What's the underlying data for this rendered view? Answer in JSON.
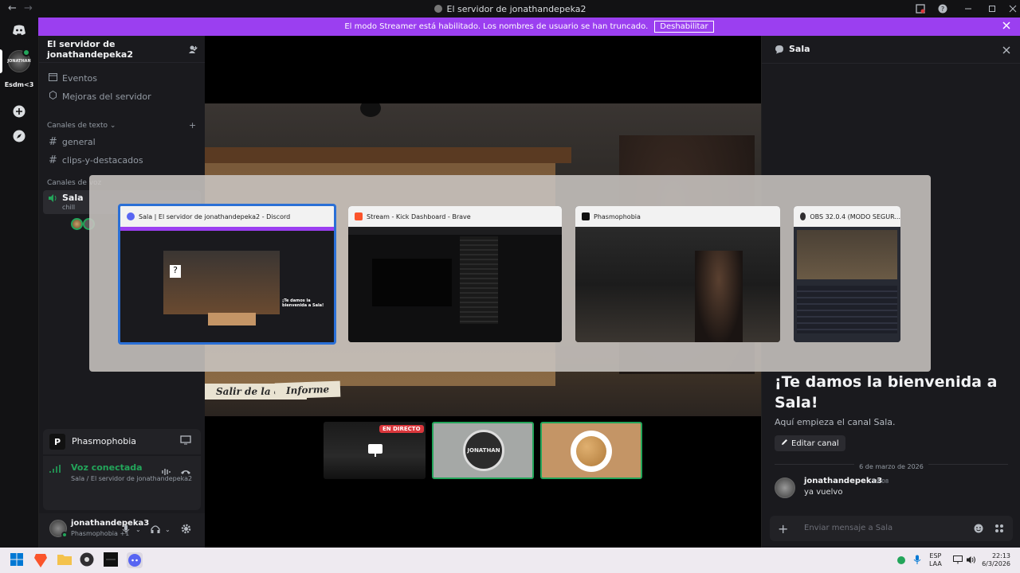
{
  "window": {
    "title": "El servidor de jonathandepeka2",
    "back_glyph": "←",
    "forward_glyph": "→"
  },
  "banner": {
    "text": "El modo Streamer está habilitado. Los nombres de usuario se han truncado.",
    "button": "Deshabilitar"
  },
  "rail": {
    "server_label": "Esdm<3"
  },
  "sidebar": {
    "server_name": "El servidor de jonathandepeka2",
    "items": [
      {
        "label": "Eventos",
        "icon": "calendar-icon"
      },
      {
        "label": "Mejoras del servidor",
        "icon": "boost-icon"
      }
    ],
    "text_category": "Canales de texto",
    "text_channels": [
      "general",
      "clips-y-destacados"
    ],
    "voice_category": "Canales de voz",
    "voice_channel": {
      "name": "Sala",
      "status": "chill"
    }
  },
  "activity": {
    "game": "Phasmophobia"
  },
  "voice": {
    "status": "Voz conectada",
    "location": "Sala / El servidor de jonathandepeka2"
  },
  "user": {
    "name": "jonathandepeka3",
    "activity": "Phasmophobia +1"
  },
  "stream": {
    "live_badge": "EN DIRECTO",
    "paper_left": "Salir de la cala",
    "paper_right": "Informe",
    "tile_logo_text": "JONATHAN"
  },
  "right_panel": {
    "channel_name": "Sala",
    "welcome_title": "¡Te damos la bienvenida a Sala!",
    "welcome_sub": "Aquí empieza el canal Sala.",
    "edit_button": "Editar canal",
    "date_divider": "6 de marzo de 2026",
    "message": {
      "author": "jonathandepeka3",
      "time": "19:08",
      "text": "ya vuelvo"
    },
    "input_placeholder": "Enviar mensaje a Sala"
  },
  "alttab": {
    "windows": [
      {
        "title": "Sala | El servidor de jonathandepeka2 - Discord",
        "icon_color": "#5865f2"
      },
      {
        "title": "Stream - Kick Dashboard - Brave",
        "icon_color": "#fb542b"
      },
      {
        "title": "Phasmophobia",
        "icon_color": "#111111"
      },
      {
        "title": "OBS 32.0.4 (MODO SEGUR...",
        "icon_color": "#302e31"
      }
    ],
    "thumb_discord_welcome": "¡Te damos la bienvenida a Sala!"
  },
  "taskbar": {
    "lang_top": "ESP",
    "lang_bottom": "LAA",
    "time": "22:13",
    "date": "6/3/2026"
  },
  "colors": {
    "accent_purple": "#9b3ff0",
    "voice_green": "#23a55a",
    "live_red": "#da373c"
  }
}
